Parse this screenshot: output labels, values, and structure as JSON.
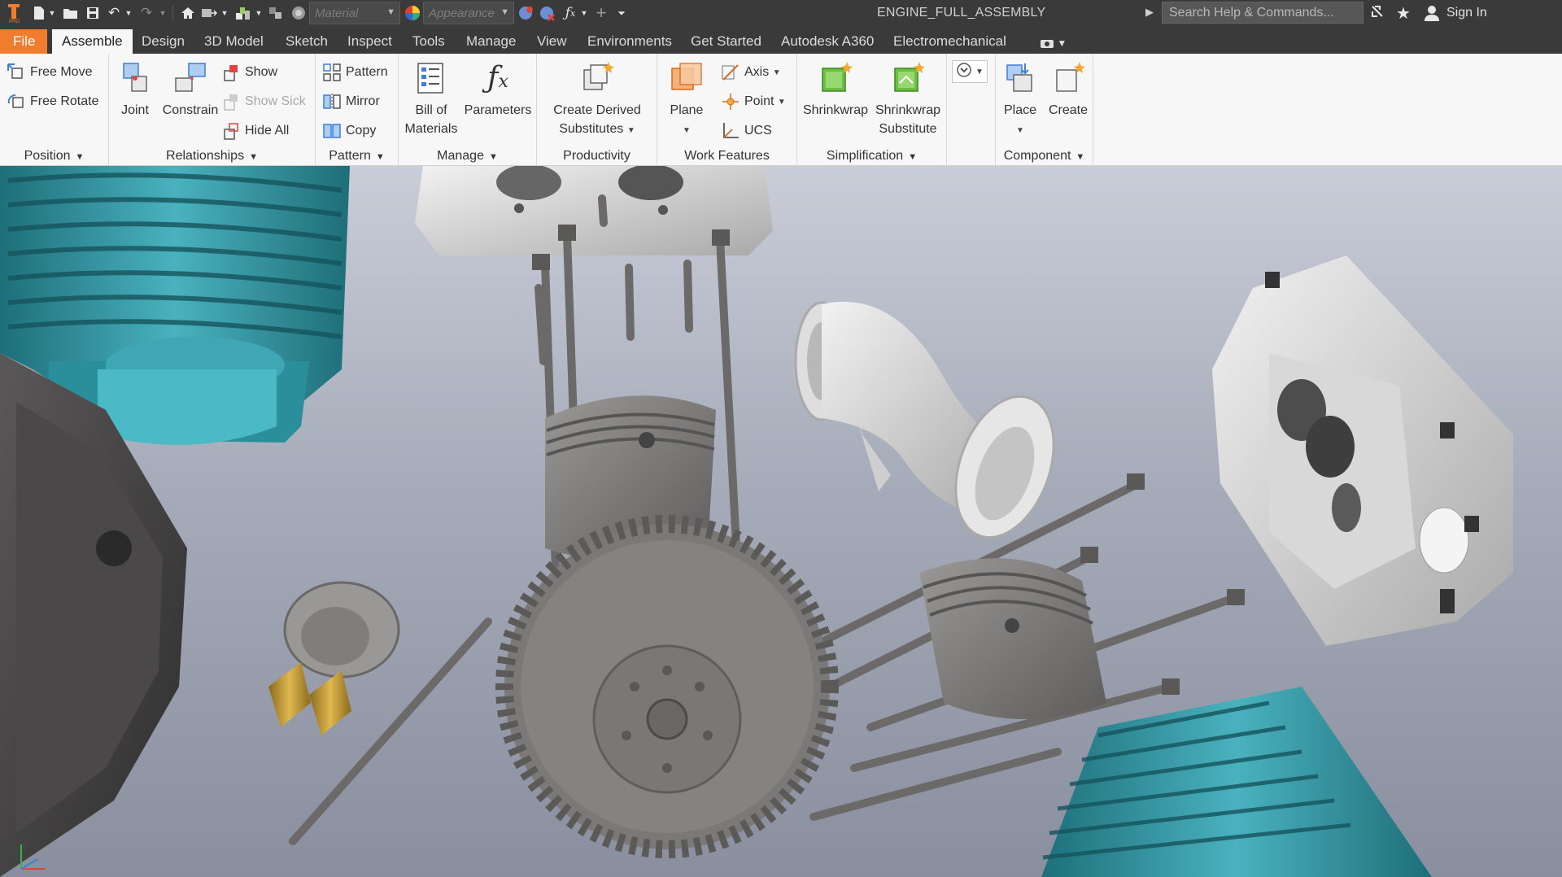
{
  "app": {
    "document_title": "ENGINE_FULL_ASSEMBLY",
    "material_placeholder": "Material",
    "appearance_placeholder": "Appearance",
    "search_placeholder": "Search Help & Commands...",
    "sign_in": "Sign In",
    "brand_color": "#f07d2d"
  },
  "quick_access": [
    "new-icon",
    "open-icon",
    "save-icon",
    "undo-icon",
    "redo-icon",
    "home-icon",
    "update-icon",
    "measure-icon",
    "select-icon",
    "material-icon",
    "appearance-icon",
    "clear-override-icon",
    "parameters-icon",
    "add-icon",
    "customize-icon"
  ],
  "tabs": [
    {
      "label": "File"
    },
    {
      "label": "Assemble"
    },
    {
      "label": "Design"
    },
    {
      "label": "3D Model"
    },
    {
      "label": "Sketch"
    },
    {
      "label": "Inspect"
    },
    {
      "label": "Tools"
    },
    {
      "label": "Manage"
    },
    {
      "label": "View"
    },
    {
      "label": "Environments"
    },
    {
      "label": "Get Started"
    },
    {
      "label": "Autodesk A360"
    },
    {
      "label": "Electromechanical"
    }
  ],
  "ribbon": {
    "position": {
      "title": "Position",
      "free_move": "Free Move",
      "free_rotate": "Free Rotate"
    },
    "relationships": {
      "title": "Relationships",
      "joint": "Joint",
      "constrain": "Constrain",
      "show": "Show",
      "show_sick": "Show Sick",
      "hide_all": "Hide All"
    },
    "pattern": {
      "title": "Pattern",
      "pattern": "Pattern",
      "mirror": "Mirror",
      "copy": "Copy"
    },
    "manage": {
      "title": "Manage",
      "bom_line1": "Bill of",
      "bom_line2": "Materials",
      "parameters": "Parameters"
    },
    "productivity": {
      "title": "Productivity",
      "cds_line1": "Create Derived",
      "cds_line2": "Substitutes"
    },
    "work_features": {
      "title": "Work Features",
      "plane": "Plane",
      "axis": "Axis",
      "point": "Point",
      "ucs": "UCS"
    },
    "simplification": {
      "title": "Simplification",
      "shrinkwrap": "Shrinkwrap",
      "sws_line1": "Shrinkwrap",
      "sws_line2": "Substitute"
    },
    "component": {
      "title": "Component",
      "place": "Place",
      "create": "Create"
    }
  },
  "viewport": {
    "model": "exploded engine assembly",
    "colors": {
      "cylinder": "#3a9eaa",
      "parts": "#7e7c7a",
      "housing": "#dcdcdc",
      "brass": "#c9a43e"
    }
  }
}
